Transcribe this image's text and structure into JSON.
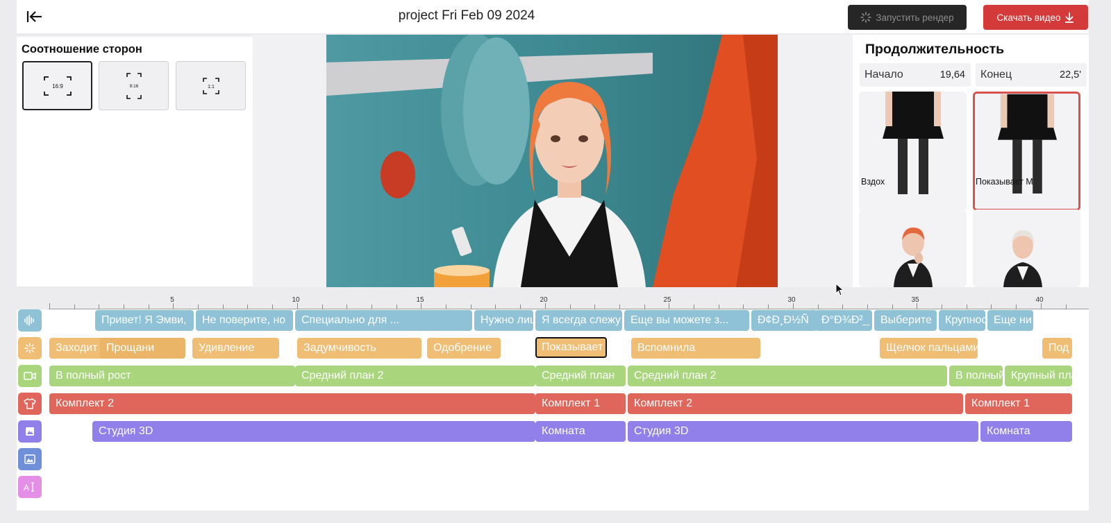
{
  "header": {
    "project_title": "project Fri Feb 09 2024",
    "render_label": "Запустить рендер",
    "download_label": "Скачать видео"
  },
  "aspect": {
    "title": "Соотношение сторон",
    "options": [
      {
        "label": "16:9",
        "selected": true
      },
      {
        "label": "9:16",
        "selected": false
      },
      {
        "label": "1:1",
        "selected": false
      }
    ]
  },
  "duration": {
    "title": "Продолжительность",
    "start_label": "Начало",
    "start_value": "19,64",
    "end_label": "Конец",
    "end_value": "22,5'"
  },
  "gestures": [
    {
      "caption": "Вздох",
      "selected": false
    },
    {
      "caption": "Показывает М",
      "selected": true
    },
    {
      "caption": "",
      "selected": false
    },
    {
      "caption": "",
      "selected": false
    }
  ],
  "ruler": {
    "labels": [
      "5",
      "10",
      "15",
      "20",
      "25",
      "30",
      "35",
      "40"
    ]
  },
  "tracks": {
    "speech": [
      "Привет! Я Эмви,",
      "Не поверите, но",
      "Специально для ...",
      "Нужно лиш",
      "Я всегда слежу",
      "Еще вы можете з...",
      "Ð¢Ð¸Ð½Ñ",
      "Ð°Ð¾Ð²_",
      "Выберите",
      "Крупнос",
      "Еще ни"
    ],
    "emotion": [
      "Заходит",
      "Прощани",
      "Удивление",
      "Задумчивость",
      "Одобрение",
      "Показывает",
      "Вспомнила",
      "Щелчок пальцами",
      "Под"
    ],
    "camera": [
      "В полный рост",
      "Средний план 2",
      "Средний план",
      "Средний план 2",
      "В полный",
      "Крупный план"
    ],
    "outfit": [
      "Комплект 2",
      "Комплект 1",
      "Комплект 2",
      "Комплект 1"
    ],
    "scene": [
      "Студия 3D",
      "Комната",
      "Студия 3D",
      "Комната"
    ]
  },
  "colors": {
    "speech": "#8fc2d6",
    "emotion": "#efbd73",
    "camera": "#a9d67d",
    "outfit": "#e0665b",
    "scene": "#9180ea",
    "image": "#6f8fd8",
    "text": "#e48ee8",
    "download": "#d53a3a"
  },
  "icons": {
    "speech": "sound-wave-icon",
    "emotion": "sparkle-icon",
    "camera": "video-camera-icon",
    "outfit": "tshirt-icon",
    "scene": "scene-icon",
    "image": "image-icon",
    "text": "text-cursor-icon"
  }
}
